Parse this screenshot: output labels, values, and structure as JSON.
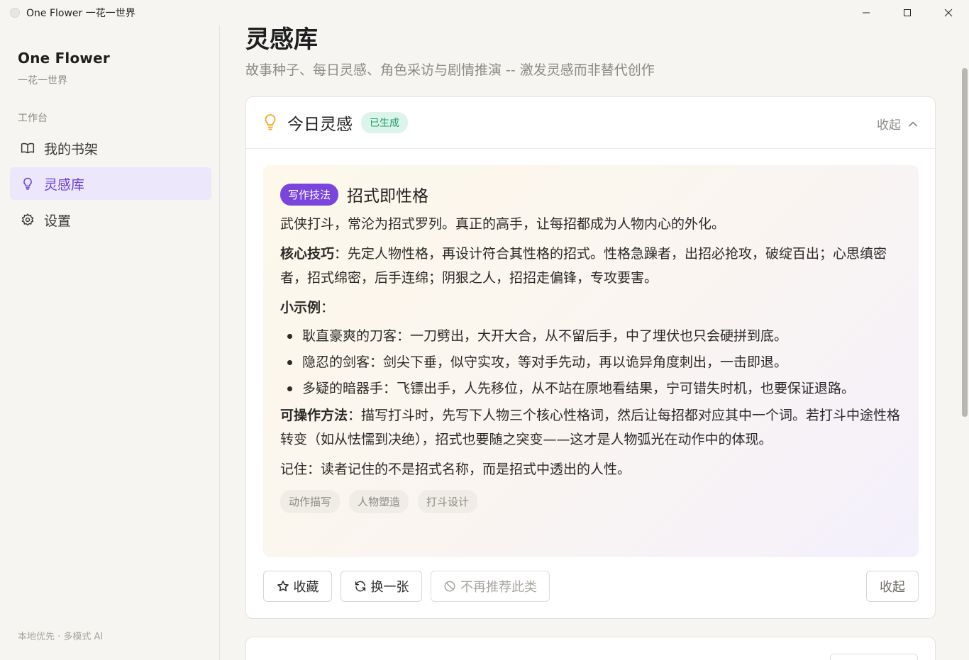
{
  "window": {
    "title": "One Flower 一花一世界"
  },
  "sidebar": {
    "brand_name": "One Flower",
    "brand_sub": "一花一世界",
    "section_label": "工作台",
    "items": [
      {
        "label": "我的书架",
        "icon": "book-icon"
      },
      {
        "label": "灵感库",
        "icon": "lightbulb-icon",
        "active": true
      },
      {
        "label": "设置",
        "icon": "gear-icon"
      }
    ],
    "footer": "本地优先 · 多模式 AI"
  },
  "page": {
    "title": "灵感库",
    "subtitle": "故事种子、每日灵感、角色采访与剧情推演 -- 激发灵感而非替代创作"
  },
  "daily_card": {
    "title": "今日灵感",
    "status_badge": "已生成",
    "collapse_label": "收起",
    "inspiration": {
      "category": "写作技法",
      "title": "招式即性格",
      "intro": "武侠打斗，常沦为招式罗列。真正的高手，让每招都成为人物内心的外化。",
      "core_label": "核心技巧",
      "core_text": "：先定人物性格，再设计符合其性格的招式。性格急躁者，出招必抢攻，破绽百出；心思缜密者，招式绵密，后手连绵；阴狠之人，招招走偏锋，专攻要害。",
      "example_label": "小示例",
      "example_colon": "：",
      "examples": [
        "耿直豪爽的刀客：一刀劈出，大开大合，从不留后手，中了埋伏也只会硬拼到底。",
        "隐忍的剑客：剑尖下垂，似守实攻，等对手先动，再以诡异角度刺出，一击即退。",
        "多疑的暗器手：飞镖出手，人先移位，从不站在原地看结果，宁可错失时机，也要保证退路。"
      ],
      "method_label": "可操作方法",
      "method_text": "：描写打斗时，先写下人物三个核心性格词，然后让每招都对应其中一个词。若打斗中途性格转变（如从怯懦到决绝），招式也要随之突变——这才是人物弧光在动作中的体现。",
      "remember": "记住：读者记住的不是招式名称，而是招式中透出的人性。",
      "tags": [
        "动作描写",
        "人物塑造",
        "打斗设计"
      ]
    },
    "actions": {
      "favorite": "收藏",
      "next": "换一张",
      "no_more": "不再推荐此类",
      "collapse": "收起"
    }
  },
  "colors": {
    "accent": "#7a45dd",
    "active_nav_bg": "#ece7fb",
    "status_green": "#1f9b66",
    "bulb": "#f0a81e"
  }
}
